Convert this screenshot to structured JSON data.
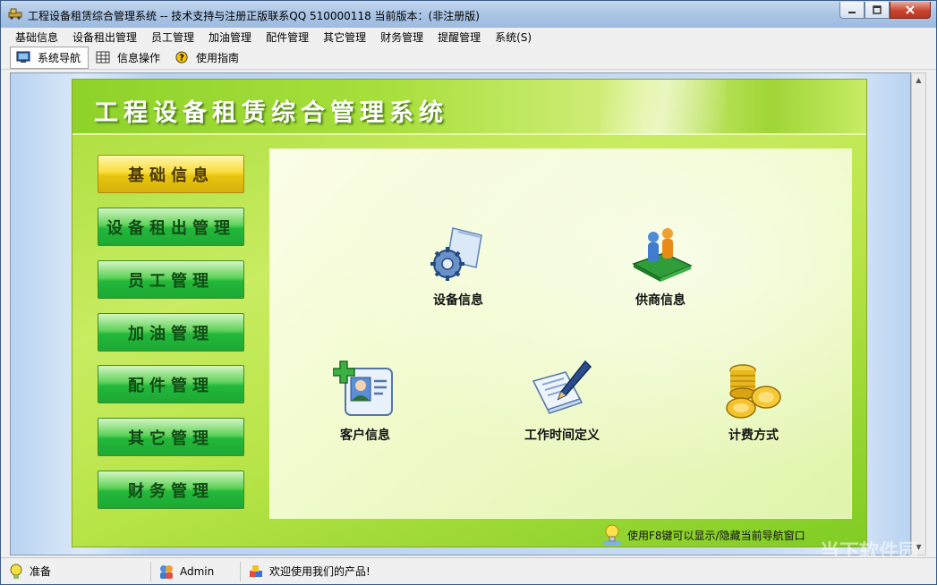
{
  "window": {
    "title": "工程设备租赁综合管理系统 -- 技术支持与注册正版联系QQ 510000118    当前版本：(非注册版)"
  },
  "menubar": {
    "items": [
      "基础信息",
      "设备租出管理",
      "员工管理",
      "加油管理",
      "配件管理",
      "其它管理",
      "财务管理",
      "提醒管理",
      "系统(S)"
    ]
  },
  "toolbar": {
    "buttons": [
      {
        "label": "系统导航",
        "icon": "monitor-icon",
        "active": true
      },
      {
        "label": "信息操作",
        "icon": "grid-icon",
        "active": false
      },
      {
        "label": "使用指南",
        "icon": "help-icon",
        "active": false
      }
    ]
  },
  "nav": {
    "title": "工程设备租赁综合管理系统",
    "side_buttons": [
      {
        "label": "基础信息",
        "active": true
      },
      {
        "label": "设备租出管理",
        "active": false
      },
      {
        "label": "员工管理",
        "active": false
      },
      {
        "label": "加油管理",
        "active": false
      },
      {
        "label": "配件管理",
        "active": false
      },
      {
        "label": "其它管理",
        "active": false
      },
      {
        "label": "财务管理",
        "active": false
      }
    ],
    "entries": [
      {
        "label": "设备信息",
        "icon": "gear-document-icon"
      },
      {
        "label": "供商信息",
        "icon": "people-book-icon"
      },
      {
        "label": "客户信息",
        "icon": "add-contact-card-icon"
      },
      {
        "label": "工作时间定义",
        "icon": "pen-paper-icon"
      },
      {
        "label": "计费方式",
        "icon": "gold-coins-icon"
      }
    ],
    "hint": "使用F8键可以显示/隐藏当前导航窗口"
  },
  "statusbar": {
    "status": "准备",
    "user": "Admin",
    "message": "欢迎使用我们的产品!"
  },
  "watermark": "当下软件园",
  "colors": {
    "accent": "#8ed22a",
    "active_button": "#e8c410",
    "side_button": "#22b83a"
  }
}
